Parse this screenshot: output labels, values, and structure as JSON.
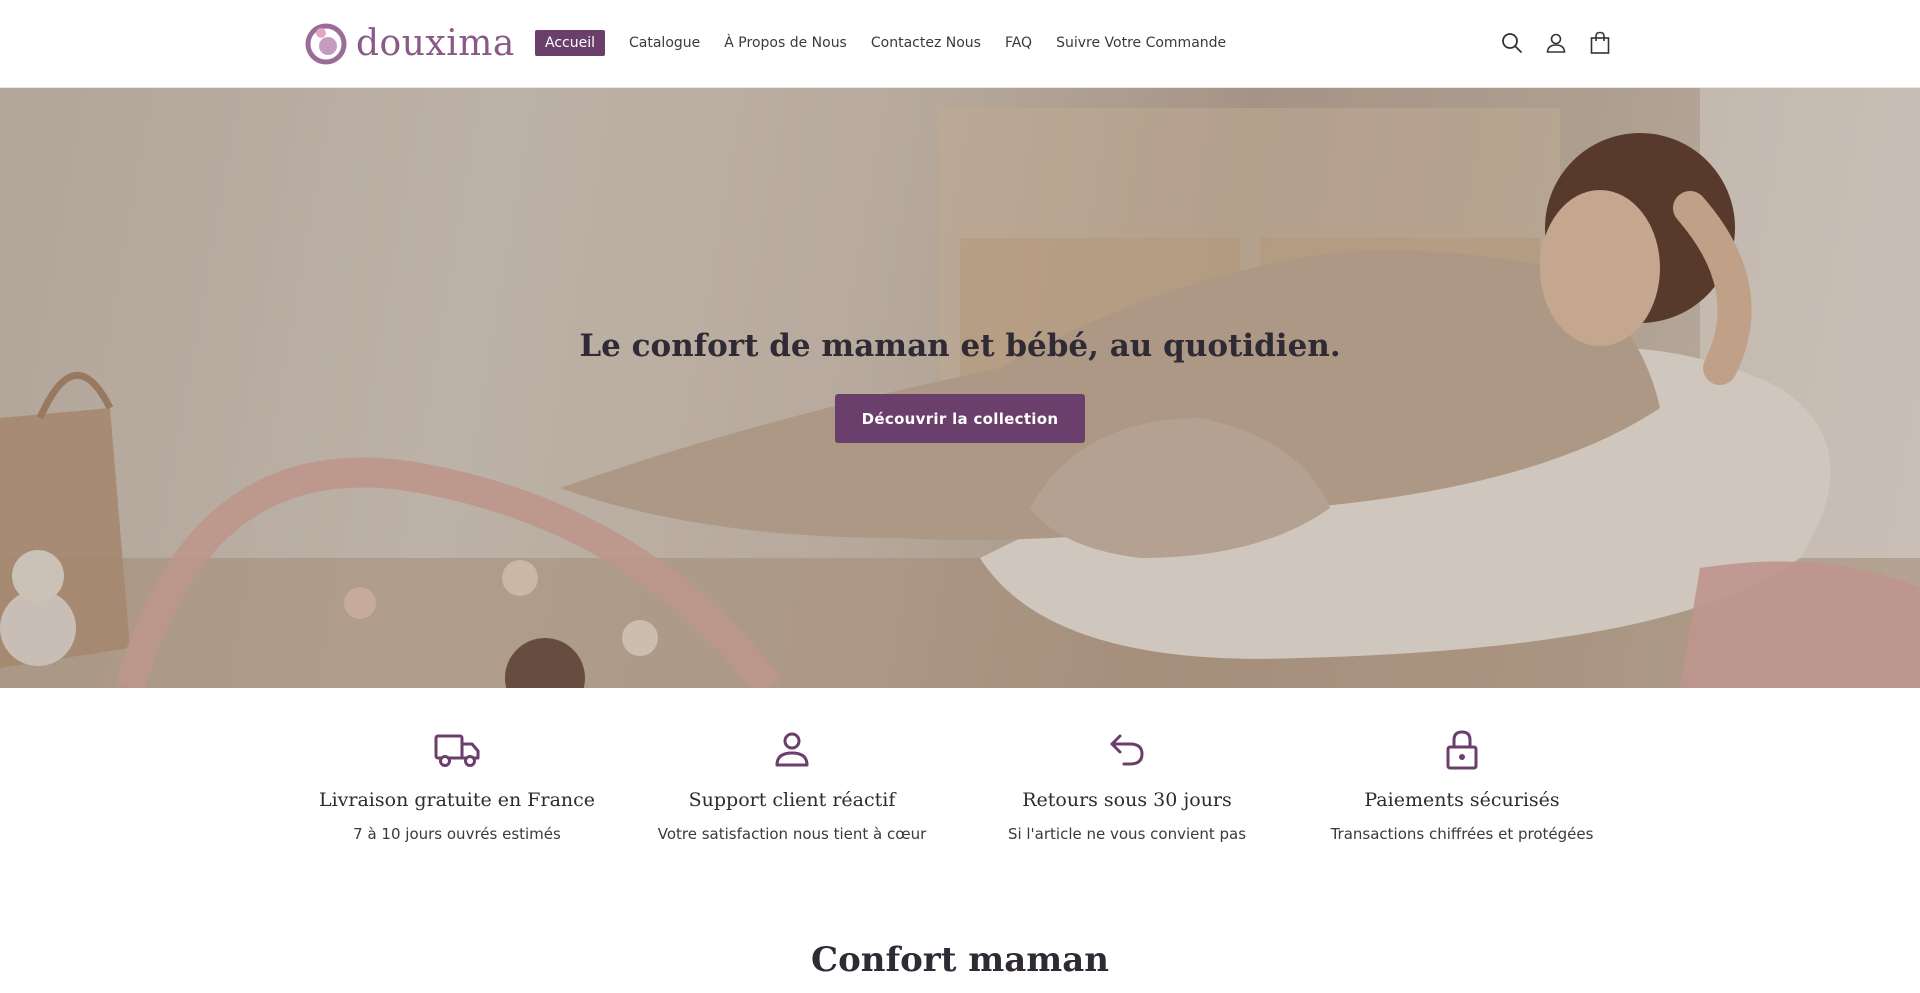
{
  "brand": {
    "name": "douxima",
    "logo_color": "#8a5a86"
  },
  "nav": {
    "items": [
      {
        "label": "Accueil",
        "active": true
      },
      {
        "label": "Catalogue",
        "active": false
      },
      {
        "label": "À Propos de Nous",
        "active": false
      },
      {
        "label": "Contactez Nous",
        "active": false
      },
      {
        "label": "FAQ",
        "active": false
      },
      {
        "label": "Suivre Votre Commande",
        "active": false
      }
    ]
  },
  "header_icons": [
    "search-icon",
    "account-icon",
    "cart-icon"
  ],
  "hero": {
    "title": "Le confort de maman et bébé, au quotidien.",
    "cta_label": "Découvrir la collection"
  },
  "features": [
    {
      "icon": "truck-icon",
      "title": "Livraison gratuite en France",
      "desc": "7 à 10 jours ouvrés estimés"
    },
    {
      "icon": "person-icon",
      "title": "Support client réactif",
      "desc": "Votre satisfaction nous tient à cœur"
    },
    {
      "icon": "return-icon",
      "title": "Retours sous 30 jours",
      "desc": "Si l'article ne vous convient pas"
    },
    {
      "icon": "lock-icon",
      "title": "Paiements sécurisés",
      "desc": "Transactions chiffrées et protégées"
    }
  ],
  "section": {
    "title": "Confort maman"
  },
  "colors": {
    "accent": "#6a3f6c",
    "text": "#2f2a33"
  }
}
